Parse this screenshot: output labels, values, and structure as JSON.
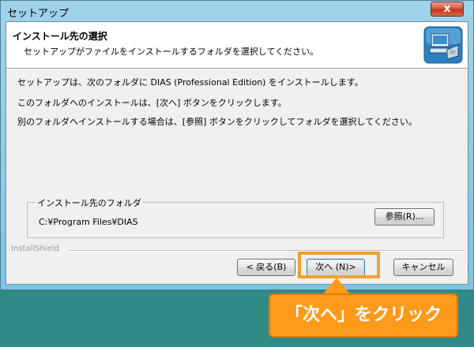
{
  "window": {
    "title": "セットアップ",
    "close_label": "x"
  },
  "header": {
    "title": "インストール先の選択",
    "subtitle": "セットアップがファイルをインストールするフォルダを選択してください。"
  },
  "body": {
    "line1": "セットアップは、次のフォルダに DIAS (Professional Edition) をインストールします。",
    "line2": "このフォルダへのインストールは、[次へ] ボタンをクリックします。",
    "line3": "別のフォルダへインストールする場合は、[参照] ボタンをクリックしてフォルダを選択してください。"
  },
  "destination": {
    "legend": "インストール先のフォルダ",
    "path": "C:¥Program Files¥DIAS",
    "browse_label": "参照(R)..."
  },
  "footer": {
    "brand": "InstallShield"
  },
  "buttons": {
    "back": "< 戻る(B)",
    "next": "次へ (N)>",
    "cancel": "キャンセル"
  },
  "callout": {
    "text": "「次へ」をクリック"
  },
  "icons": {
    "header_graphic": "computer-install-icon"
  },
  "colors": {
    "highlight": "#f0a030",
    "callout_bg": "#ff9a1a"
  }
}
